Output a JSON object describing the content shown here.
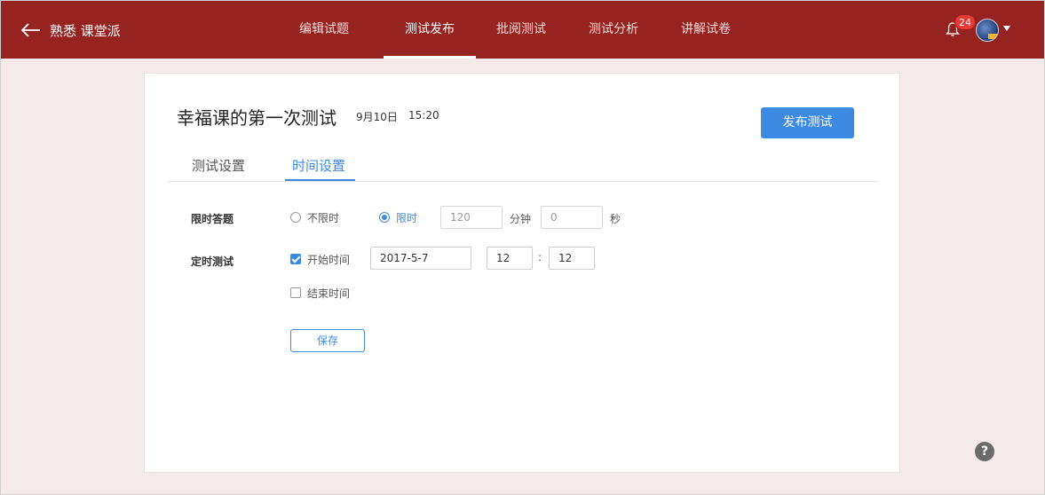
{
  "header": {
    "app_title": "熟悉 课堂派",
    "nav": [
      {
        "label": "编辑试题"
      },
      {
        "label": "测试发布"
      },
      {
        "label": "批阅测试"
      },
      {
        "label": "测试分析"
      },
      {
        "label": "讲解试卷"
      }
    ],
    "active_nav": "测试发布",
    "notification_count": "24"
  },
  "test": {
    "title": "幸福课的第一次测试",
    "date": "9月10日",
    "time": "15:20",
    "publish_label": "发布测试"
  },
  "tabs": [
    {
      "label": "测试设置"
    },
    {
      "label": "时间设置"
    }
  ],
  "active_tab": "时间设置",
  "time_limit": {
    "label": "限时答题",
    "option_unlimited": "不限时",
    "option_limited": "限时",
    "selected": "限时",
    "minutes_value": "120",
    "minutes_unit": "分钟",
    "seconds_value": "0",
    "seconds_unit": "秒"
  },
  "scheduled": {
    "label": "定时测试",
    "start_label": "开始时间",
    "start_checked": true,
    "start_date": "2017-5-7",
    "start_hour": "12",
    "separator": ":",
    "start_minute": "12",
    "end_label": "结束时间",
    "end_checked": false
  },
  "save_label": "保存",
  "help_label": "?",
  "colors": {
    "header_bg": "#962320",
    "accent": "#3d8ae3",
    "page_bg": "#f5eaea",
    "badge": "#e53935"
  },
  "icons": [
    "back-arrow-icon",
    "bell-icon",
    "caret-down-icon",
    "help-icon"
  ]
}
